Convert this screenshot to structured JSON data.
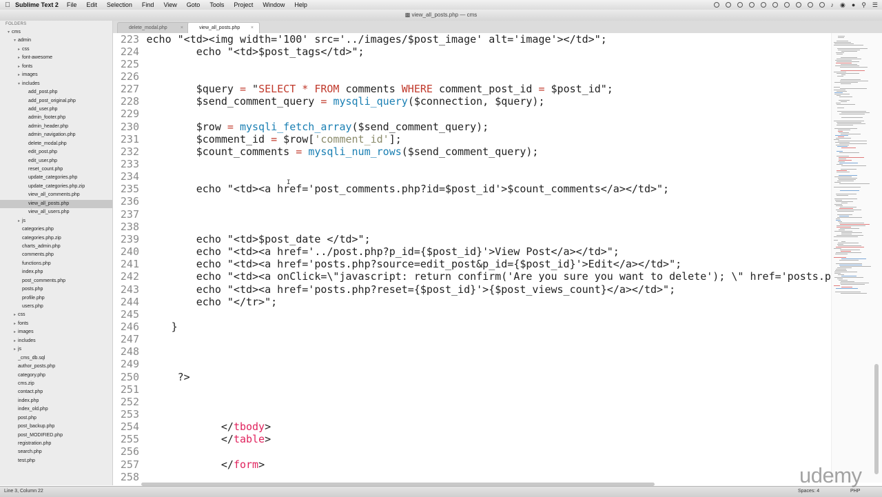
{
  "menubar": {
    "app_name": "Sublime Text 2",
    "items": [
      "File",
      "Edit",
      "Selection",
      "Find",
      "View",
      "Goto",
      "Tools",
      "Project",
      "Window",
      "Help"
    ]
  },
  "window": {
    "title": "view_all_posts.php — cms"
  },
  "sidebar": {
    "header": "FOLDERS",
    "tree": [
      {
        "label": "cms",
        "depth": 0,
        "arrow": "▾"
      },
      {
        "label": "admin",
        "depth": 1,
        "arrow": "▾"
      },
      {
        "label": "css",
        "depth": 2,
        "arrow": "▸"
      },
      {
        "label": "font-awesome",
        "depth": 2,
        "arrow": "▸"
      },
      {
        "label": "fonts",
        "depth": 2,
        "arrow": "▸"
      },
      {
        "label": "images",
        "depth": 2,
        "arrow": "▸"
      },
      {
        "label": "includes",
        "depth": 2,
        "arrow": "▾"
      },
      {
        "label": "add_post.php",
        "depth": 3,
        "arrow": ""
      },
      {
        "label": "add_post_original.php",
        "depth": 3,
        "arrow": ""
      },
      {
        "label": "add_user.php",
        "depth": 3,
        "arrow": ""
      },
      {
        "label": "admin_footer.php",
        "depth": 3,
        "arrow": ""
      },
      {
        "label": "admin_header.php",
        "depth": 3,
        "arrow": ""
      },
      {
        "label": "admin_navigation.php",
        "depth": 3,
        "arrow": ""
      },
      {
        "label": "delete_modal.php",
        "depth": 3,
        "arrow": ""
      },
      {
        "label": "edit_post.php",
        "depth": 3,
        "arrow": ""
      },
      {
        "label": "edit_user.php",
        "depth": 3,
        "arrow": ""
      },
      {
        "label": "reset_count.php",
        "depth": 3,
        "arrow": ""
      },
      {
        "label": "update_categories.php",
        "depth": 3,
        "arrow": ""
      },
      {
        "label": "update_categories.php.zip",
        "depth": 3,
        "arrow": ""
      },
      {
        "label": "view_all_comments.php",
        "depth": 3,
        "arrow": ""
      },
      {
        "label": "view_all_posts.php",
        "depth": 3,
        "arrow": "",
        "selected": true
      },
      {
        "label": "view_all_users.php",
        "depth": 3,
        "arrow": ""
      },
      {
        "label": "js",
        "depth": 2,
        "arrow": "▸"
      },
      {
        "label": "categories.php",
        "depth": 2,
        "arrow": ""
      },
      {
        "label": "categories.php.zip",
        "depth": 2,
        "arrow": ""
      },
      {
        "label": "charts_admin.php",
        "depth": 2,
        "arrow": ""
      },
      {
        "label": "comments.php",
        "depth": 2,
        "arrow": ""
      },
      {
        "label": "functions.php",
        "depth": 2,
        "arrow": ""
      },
      {
        "label": "index.php",
        "depth": 2,
        "arrow": ""
      },
      {
        "label": "post_comments.php",
        "depth": 2,
        "arrow": ""
      },
      {
        "label": "posts.php",
        "depth": 2,
        "arrow": ""
      },
      {
        "label": "profile.php",
        "depth": 2,
        "arrow": ""
      },
      {
        "label": "users.php",
        "depth": 2,
        "arrow": ""
      },
      {
        "label": "css",
        "depth": 1,
        "arrow": "▸"
      },
      {
        "label": "fonts",
        "depth": 1,
        "arrow": "▸"
      },
      {
        "label": "images",
        "depth": 1,
        "arrow": "▸"
      },
      {
        "label": "includes",
        "depth": 1,
        "arrow": "▸"
      },
      {
        "label": "js",
        "depth": 1,
        "arrow": "▸"
      },
      {
        "label": "_cms_db.sql",
        "depth": 1,
        "arrow": ""
      },
      {
        "label": "author_posts.php",
        "depth": 1,
        "arrow": ""
      },
      {
        "label": "category.php",
        "depth": 1,
        "arrow": ""
      },
      {
        "label": "cms.zip",
        "depth": 1,
        "arrow": ""
      },
      {
        "label": "contact.php",
        "depth": 1,
        "arrow": ""
      },
      {
        "label": "index.php",
        "depth": 1,
        "arrow": ""
      },
      {
        "label": "index_old.php",
        "depth": 1,
        "arrow": ""
      },
      {
        "label": "post.php",
        "depth": 1,
        "arrow": ""
      },
      {
        "label": "post_backup.php",
        "depth": 1,
        "arrow": ""
      },
      {
        "label": "post_MODIFIED.php",
        "depth": 1,
        "arrow": ""
      },
      {
        "label": "registration.php",
        "depth": 1,
        "arrow": ""
      },
      {
        "label": "search.php",
        "depth": 1,
        "arrow": ""
      },
      {
        "label": "test.php",
        "depth": 1,
        "arrow": ""
      }
    ]
  },
  "tabs": [
    {
      "label": "delete_modal.php",
      "active": false
    },
    {
      "label": "view_all_posts.php",
      "active": true
    }
  ],
  "editor": {
    "lines": [
      {
        "n": "223",
        "segs": [
          [
            "",
            "echo \"<td><img width='100' src='../images/$post_image' alt='image'></td>\";"
          ]
        ]
      },
      {
        "n": "224",
        "segs": [
          [
            "",
            "        echo \"<td>$post_tags</td>\";"
          ]
        ]
      },
      {
        "n": "225",
        "segs": []
      },
      {
        "n": "226",
        "segs": []
      },
      {
        "n": "227",
        "segs": [
          [
            "",
            "        $query "
          ],
          [
            "kw",
            "="
          ],
          [
            "",
            " \""
          ],
          [
            "kw",
            "SELECT"
          ],
          [
            "",
            " "
          ],
          [
            "kw",
            "*"
          ],
          [
            "",
            " "
          ],
          [
            "kw",
            "FROM"
          ],
          [
            "",
            " comments "
          ],
          [
            "kw",
            "WHERE"
          ],
          [
            "",
            " comment_post_id "
          ],
          [
            "kw",
            "="
          ],
          [
            "",
            " $post_id\";"
          ]
        ]
      },
      {
        "n": "228",
        "segs": [
          [
            "",
            "        $send_comment_query "
          ],
          [
            "kw",
            "="
          ],
          [
            "",
            " "
          ],
          [
            "fn",
            "mysqli_query"
          ],
          [
            "",
            "($connection, $query);"
          ]
        ]
      },
      {
        "n": "229",
        "segs": []
      },
      {
        "n": "230",
        "segs": [
          [
            "",
            "        $row "
          ],
          [
            "kw",
            "="
          ],
          [
            "",
            " "
          ],
          [
            "fn",
            "mysqli_fetch_array"
          ],
          [
            "",
            "($send_comment_query);"
          ]
        ]
      },
      {
        "n": "231",
        "segs": [
          [
            "",
            "        $comment_id "
          ],
          [
            "kw",
            "="
          ],
          [
            "",
            " $row["
          ],
          [
            "str",
            "'comment_id'"
          ],
          [
            "",
            "];"
          ]
        ]
      },
      {
        "n": "232",
        "segs": [
          [
            "",
            "        $count_comments "
          ],
          [
            "kw",
            "="
          ],
          [
            "",
            " "
          ],
          [
            "fn",
            "mysqli_num_rows"
          ],
          [
            "",
            "($send_comment_query);"
          ]
        ]
      },
      {
        "n": "233",
        "segs": []
      },
      {
        "n": "234",
        "segs": []
      },
      {
        "n": "235",
        "segs": [
          [
            "",
            "        echo \"<td><a href='post_comments.php?id=$post_id'>$count_comments</a></td>\";"
          ]
        ]
      },
      {
        "n": "236",
        "segs": []
      },
      {
        "n": "237",
        "segs": []
      },
      {
        "n": "238",
        "segs": []
      },
      {
        "n": "239",
        "segs": [
          [
            "",
            "        echo \"<td>$post_date </td>\";"
          ]
        ]
      },
      {
        "n": "240",
        "segs": [
          [
            "",
            "        echo \"<td><a href='../post.php?p_id={$post_id}'>View Post</a></td>\";"
          ]
        ]
      },
      {
        "n": "241",
        "segs": [
          [
            "",
            "        echo \"<td><a href='posts.php?source=edit_post&p_id={$post_id}'>Edit</a></td>\";"
          ]
        ]
      },
      {
        "n": "242",
        "segs": [
          [
            "",
            "        echo \"<td><a onClick=\\\"javascript: return confirm('Are you sure you want to delete'); \\\" href='posts.p"
          ]
        ]
      },
      {
        "n": "243",
        "segs": [
          [
            "",
            "        echo \"<td><a href='posts.php?reset={$post_id}'>{$post_views_count}</a></td>\";"
          ]
        ]
      },
      {
        "n": "244",
        "segs": [
          [
            "",
            "        echo \"</tr>\";"
          ]
        ]
      },
      {
        "n": "245",
        "segs": []
      },
      {
        "n": "246",
        "segs": [
          [
            "",
            "    }"
          ]
        ]
      },
      {
        "n": "247",
        "segs": []
      },
      {
        "n": "248",
        "segs": []
      },
      {
        "n": "249",
        "segs": []
      },
      {
        "n": "250",
        "segs": [
          [
            "",
            "     ?>"
          ]
        ]
      },
      {
        "n": "251",
        "segs": []
      },
      {
        "n": "252",
        "segs": []
      },
      {
        "n": "253",
        "segs": []
      },
      {
        "n": "254",
        "segs": [
          [
            "",
            "            </"
          ],
          [
            "tg",
            "tbody"
          ],
          [
            "",
            ">"
          ]
        ]
      },
      {
        "n": "255",
        "segs": [
          [
            "",
            "            </"
          ],
          [
            "tg",
            "table"
          ],
          [
            "",
            ">"
          ]
        ]
      },
      {
        "n": "256",
        "segs": []
      },
      {
        "n": "257",
        "segs": [
          [
            "",
            "            </"
          ],
          [
            "tg",
            "form"
          ],
          [
            "",
            ">"
          ]
        ]
      },
      {
        "n": "258",
        "segs": []
      }
    ]
  },
  "statusbar": {
    "position": "Line 3, Column 22",
    "spaces": "Spaces: 4",
    "syntax": "PHP"
  },
  "watermark": "udemy"
}
